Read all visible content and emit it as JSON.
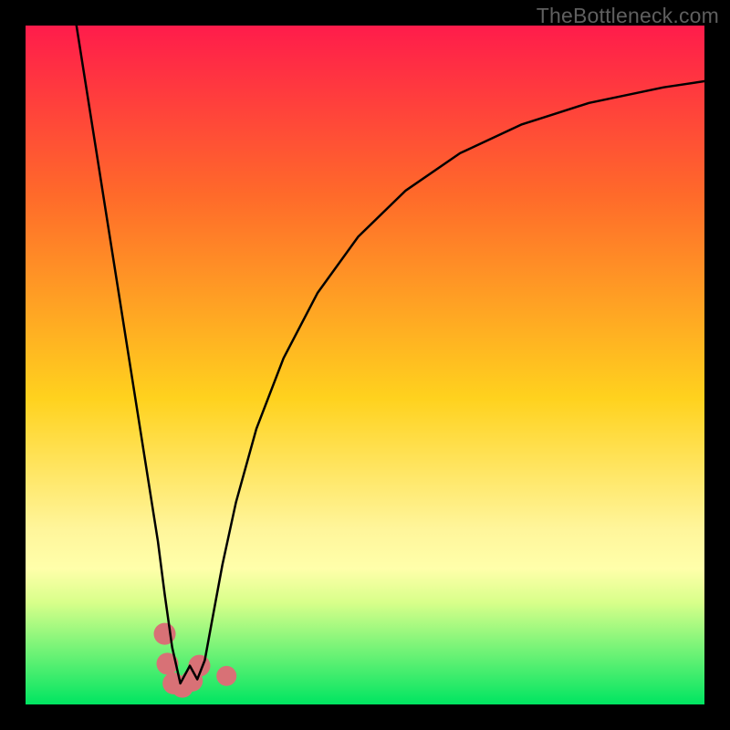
{
  "attribution": "TheBottleneck.com",
  "chart_data": {
    "type": "line",
    "title": "",
    "xlabel": "",
    "ylabel": "",
    "xlim": [
      0,
      100
    ],
    "ylim": [
      0,
      100
    ],
    "gradient_stops": [
      {
        "offset": 0,
        "color": "#ff1c4b"
      },
      {
        "offset": 25,
        "color": "#ff6a2a"
      },
      {
        "offset": 55,
        "color": "#ffd21e"
      },
      {
        "offset": 74,
        "color": "#fff59a"
      },
      {
        "offset": 80,
        "color": "#ffffaa"
      },
      {
        "offset": 85,
        "color": "#d8ff8a"
      },
      {
        "offset": 100,
        "color": "#00e561"
      }
    ],
    "series": [
      {
        "name": "bottleneck-curve",
        "stroke": "#000000",
        "stroke_width": 2.5,
        "x": [
          7.5,
          9,
          10.5,
          12,
          13.5,
          15,
          16.5,
          18,
          19.5,
          20.5,
          21.6,
          22.8,
          23.5,
          24.2,
          25.3,
          26.4,
          27.5,
          29,
          31,
          34,
          38,
          43,
          49,
          56,
          64,
          73,
          83,
          94,
          100
        ],
        "y": [
          100,
          90.5,
          81,
          71.5,
          62,
          52.5,
          43,
          33.5,
          24,
          16.2,
          8.4,
          3.1,
          4.4,
          5.7,
          3.7,
          6.5,
          12.5,
          20.6,
          29.8,
          40.6,
          51,
          60.6,
          68.9,
          75.7,
          81.2,
          85.4,
          88.6,
          90.9,
          91.8
        ]
      }
    ],
    "markers": [
      {
        "name": "marker-1",
        "cx": 20.5,
        "cy": 10.4,
        "r": 12,
        "color": "#d87176"
      },
      {
        "name": "marker-2",
        "cx": 20.9,
        "cy": 6.0,
        "r": 12,
        "color": "#d87176"
      },
      {
        "name": "marker-3",
        "cx": 21.8,
        "cy": 3.1,
        "r": 12,
        "color": "#d87176"
      },
      {
        "name": "marker-4",
        "cx": 23.1,
        "cy": 2.6,
        "r": 12,
        "color": "#d87176"
      },
      {
        "name": "marker-5",
        "cx": 24.5,
        "cy": 3.5,
        "r": 12,
        "color": "#d87176"
      },
      {
        "name": "marker-6",
        "cx": 25.6,
        "cy": 5.7,
        "r": 12,
        "color": "#d87176"
      },
      {
        "name": "marker-7",
        "cx": 29.6,
        "cy": 4.2,
        "r": 11,
        "color": "#d87176"
      }
    ]
  }
}
